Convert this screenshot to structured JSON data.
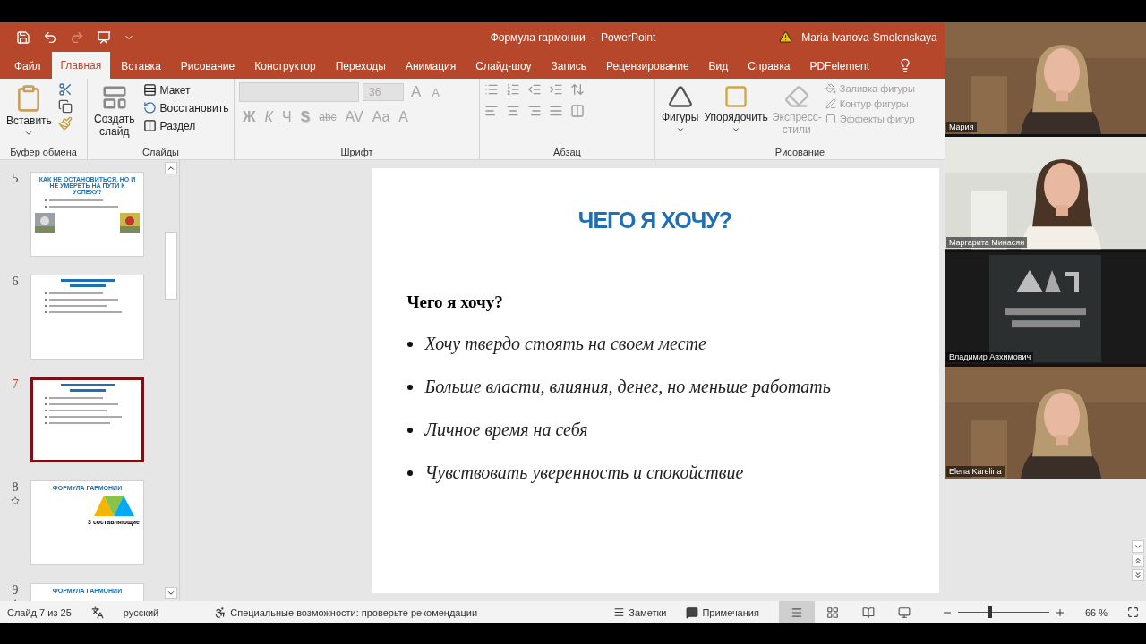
{
  "window": {
    "title": "Формула гармонии  -  PowerPoint",
    "user": "Maria Ivanova-Smolenskaya"
  },
  "quick_access": [
    {
      "kind": "save",
      "disabled": false
    },
    {
      "kind": "undo",
      "disabled": false
    },
    {
      "kind": "redo",
      "disabled": true
    },
    {
      "kind": "present",
      "disabled": false
    },
    {
      "kind": "customize",
      "disabled": false
    }
  ],
  "tabs": [
    {
      "label": "Файл",
      "selected": false
    },
    {
      "label": "Главная",
      "selected": true
    },
    {
      "label": "Вставка",
      "selected": false
    },
    {
      "label": "Рисование",
      "selected": false
    },
    {
      "label": "Конструктор",
      "selected": false
    },
    {
      "label": "Переходы",
      "selected": false
    },
    {
      "label": "Анимация",
      "selected": false
    },
    {
      "label": "Слайд-шоу",
      "selected": false
    },
    {
      "label": "Запись",
      "selected": false
    },
    {
      "label": "Рецензирование",
      "selected": false
    },
    {
      "label": "Вид",
      "selected": false
    },
    {
      "label": "Справка",
      "selected": false
    },
    {
      "label": "PDFelement",
      "selected": false
    }
  ],
  "ribbon": {
    "clipboard": {
      "label": "Буфер обмена",
      "paste": "Вставить"
    },
    "slides": {
      "label": "Слайды",
      "new_slide": "Создать слайд",
      "layout": "Макет",
      "reset": "Восстановить",
      "section": "Раздел"
    },
    "font": {
      "label": "Шрифт",
      "size": "36",
      "disabled": true,
      "size_buttons": [
        "A",
        "A"
      ],
      "buttons": [
        {
          "text": "Ж",
          "kind": "bold"
        },
        {
          "text": "К",
          "kind": "italic"
        },
        {
          "text": "Ч",
          "kind": "underline"
        },
        {
          "text": "S",
          "kind": "shadow"
        },
        {
          "text": "abc",
          "kind": "strike"
        },
        {
          "text": "AV",
          "kind": "spacing"
        },
        {
          "text": "Aa",
          "kind": "case"
        },
        {
          "text": "A",
          "kind": "color"
        }
      ]
    },
    "paragraph": {
      "label": "Абзац"
    },
    "drawing": {
      "label": "Рисование",
      "shapes": "Фигуры",
      "arrange": "Упорядочить",
      "styles": {
        "text": "Экспресс-стили",
        "disabled": true
      },
      "side": [
        {
          "text": "Заливка фигуры",
          "disabled": true
        },
        {
          "text": "Контур фигуры",
          "disabled": true
        },
        {
          "text": "Эффекты фигур",
          "disabled": true
        }
      ]
    }
  },
  "thumbnails": [
    {
      "number": "5",
      "selected": false,
      "animated": false,
      "kind": "photos",
      "title": "КАК НЕ ОСТАНОВИТЬСЯ, НО И НЕ УМЕРЕТЬ НА ПУТИ К УСПЕХУ?"
    },
    {
      "number": "6",
      "selected": false,
      "animated": false,
      "kind": "bullets"
    },
    {
      "number": "7",
      "selected": true,
      "animated": false,
      "kind": "bullets"
    },
    {
      "number": "8",
      "selected": false,
      "animated": true,
      "kind": "triangles",
      "title": "ФОРМУЛА ГАРМОНИИ",
      "caption": "3 составляющие"
    },
    {
      "number": "9",
      "selected": false,
      "animated": true,
      "kind": "plain",
      "title": "ФОРМУЛА ГАРМОНИИ"
    }
  ],
  "slide": {
    "title": "ЧЕГО Я ХОЧУ?",
    "heading": "Чего я хочу?",
    "bullets": [
      "Хочу твердо стоять на своем месте",
      "Больше власти, влияния, денег, но меньше работать",
      "Личное время на себя",
      "Чувствовать уверенность и спокойствие"
    ]
  },
  "participants": [
    {
      "name": "Мария",
      "kind": "camera"
    },
    {
      "name": "Маргарита Минасян",
      "kind": "camera"
    },
    {
      "name": "Владимир Авхимович",
      "kind": "logo"
    },
    {
      "name": "Elena Karelina",
      "kind": "camera"
    }
  ],
  "status_bar": {
    "slide": "Слайд 7 из 25",
    "language": "русский",
    "accessibility": "Специальные возможности: проверьте рекомендации",
    "notes": "Заметки",
    "comments": "Примечания",
    "views": [
      {
        "kind": "normal",
        "selected": true
      },
      {
        "kind": "sorter",
        "selected": false
      },
      {
        "kind": "reading",
        "selected": false
      },
      {
        "kind": "show",
        "selected": false
      }
    ],
    "zoom": {
      "level": 0.34,
      "reading": "66 %"
    }
  }
}
